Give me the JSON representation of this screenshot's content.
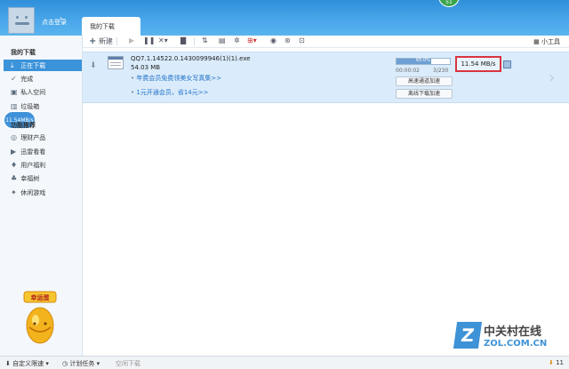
{
  "header": {
    "login_text": "点击登录",
    "login_arrow": "›",
    "tab_label": "我的下载",
    "badge": "51"
  },
  "sidebar": {
    "section_my": "我的下载",
    "items": [
      {
        "label": "正在下载",
        "icon": "download-icon",
        "active": true
      },
      {
        "label": "完成",
        "icon": "check-icon",
        "active": false
      },
      {
        "label": "私人空间",
        "icon": "folder-icon",
        "active": false
      },
      {
        "label": "垃圾箱",
        "icon": "trash-icon",
        "active": false
      }
    ],
    "section_recommend": "功能推荐",
    "rec_items": [
      {
        "label": "理财产品",
        "icon": "finance-icon"
      },
      {
        "label": "迅雷看看",
        "icon": "video-icon"
      },
      {
        "label": "用户福利",
        "icon": "gift-icon"
      },
      {
        "label": "幸福树",
        "icon": "tree-icon"
      },
      {
        "label": "休闲游戏",
        "icon": "gamepad-icon"
      }
    ],
    "speed_bubble": "11.54MB/s",
    "mascot_label": "幸运蛋"
  },
  "toolbar": {
    "new_label": "新建",
    "right_label": "小工具"
  },
  "task": {
    "filename": "QQ7.1.14522.0.1430099946(1)(1).exe",
    "size": "54.03 MB",
    "promo1": "年费会员免费领美女写真集>>",
    "promo2": "1元开通会员，省14元>>",
    "progress_text": "65.0%",
    "progress": 0.65,
    "elapsed": "00:00:02",
    "counter": "3/230",
    "btn_fast": "高速通道加速",
    "btn_offline": "离线下载加速",
    "speed": "11.54  MB/s"
  },
  "statusbar": {
    "speed_limit": "自定义限速",
    "plan": "计划任务",
    "idle": "空闲下载",
    "right_count": "11"
  },
  "watermark": {
    "cn": "中关村在线",
    "en": "ZOL.COM.CN"
  }
}
